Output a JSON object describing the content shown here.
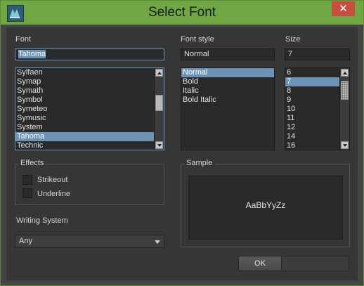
{
  "window": {
    "title": "Select Font",
    "close_icon": "✕"
  },
  "font": {
    "label": "Font",
    "value": "Tahoma",
    "list": [
      "Sylfaen",
      "Symap",
      "Symath",
      "Symbol",
      "Symeteo",
      "Symusic",
      "System",
      "Tahoma",
      "Technic"
    ],
    "selected": "Tahoma"
  },
  "font_style": {
    "label": "Font style",
    "value": "Normal",
    "list": [
      "Normal",
      "Bold",
      "Italic",
      "Bold Italic"
    ],
    "selected": "Normal"
  },
  "size": {
    "label": "Size",
    "value": "7",
    "list": [
      "6",
      "7",
      "8",
      "9",
      "10",
      "11",
      "12",
      "14",
      "16"
    ],
    "selected": "7"
  },
  "effects": {
    "title": "Effects",
    "strikeout_label": "Strikeout",
    "underline_label": "Underline",
    "strikeout_checked": false,
    "underline_checked": false
  },
  "sample": {
    "title": "Sample",
    "text": "AaBbYyZz"
  },
  "writing_system": {
    "label": "Writing System",
    "value": "Any"
  },
  "buttons": {
    "ok": "OK"
  },
  "colors": {
    "titlebar": "#6fa843",
    "selection": "#6c93b6",
    "close": "#c84c3f"
  }
}
